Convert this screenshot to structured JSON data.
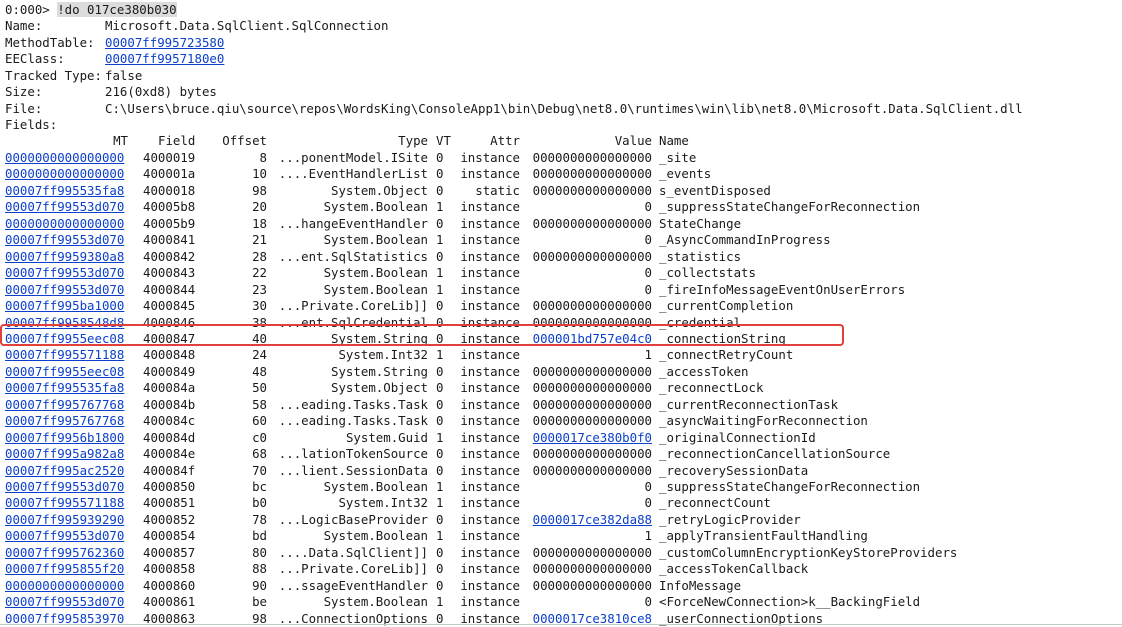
{
  "prompt": "0:000> ",
  "command": "!do 017ce380b030",
  "object_info": [
    {
      "label": "Name:",
      "value": "Microsoft.Data.SqlClient.SqlConnection",
      "link": false
    },
    {
      "label": "MethodTable:",
      "value": "00007ff995723580",
      "link": true
    },
    {
      "label": "EEClass:",
      "value": "00007ff9957180e0",
      "link": true
    },
    {
      "label": "Tracked Type:",
      "value": "false",
      "link": false
    },
    {
      "label": "Size:",
      "value": "216(0xd8) bytes",
      "link": false
    },
    {
      "label": "File:",
      "value": "C:\\Users\\bruce.qiu\\source\\repos\\WordsKing\\ConsoleApp1\\bin\\Debug\\net8.0\\runtimes\\win\\lib\\net8.0\\Microsoft.Data.SqlClient.dll",
      "link": false
    }
  ],
  "fields_label": "Fields:",
  "headers": {
    "mt": "MT",
    "field": "Field",
    "offset": "Offset",
    "type": "Type",
    "vt": "VT",
    "attr": "Attr",
    "value": "Value",
    "name": "Name"
  },
  "fields": [
    {
      "mt": "0000000000000000",
      "field": "4000019",
      "offset": "8",
      "type": "...ponentModel.ISite",
      "vt": "0",
      "attr": "instance",
      "value": "0000000000000000",
      "value_link": false,
      "name": "_site"
    },
    {
      "mt": "0000000000000000",
      "field": "400001a",
      "offset": "10",
      "type": "....EventHandlerList",
      "vt": "0",
      "attr": "instance",
      "value": "0000000000000000",
      "value_link": false,
      "name": "_events"
    },
    {
      "mt": "00007ff995535fa8",
      "field": "4000018",
      "offset": "98",
      "type": "System.Object",
      "vt": "0",
      "attr": "static",
      "value": "0000000000000000",
      "value_link": false,
      "name": "s_eventDisposed"
    },
    {
      "mt": "00007ff99553d070",
      "field": "40005b8",
      "offset": "20",
      "type": "System.Boolean",
      "vt": "1",
      "attr": "instance",
      "value": "0",
      "value_link": false,
      "name": "_suppressStateChangeForReconnection"
    },
    {
      "mt": "0000000000000000",
      "field": "40005b9",
      "offset": "18",
      "type": "...hangeEventHandler",
      "vt": "0",
      "attr": "instance",
      "value": "0000000000000000",
      "value_link": false,
      "name": "StateChange"
    },
    {
      "mt": "00007ff99553d070",
      "field": "4000841",
      "offset": "21",
      "type": "System.Boolean",
      "vt": "1",
      "attr": "instance",
      "value": "0",
      "value_link": false,
      "name": "_AsyncCommandInProgress"
    },
    {
      "mt": "00007ff9959380a8",
      "field": "4000842",
      "offset": "28",
      "type": "...ent.SqlStatistics",
      "vt": "0",
      "attr": "instance",
      "value": "0000000000000000",
      "value_link": false,
      "name": "_statistics"
    },
    {
      "mt": "00007ff99553d070",
      "field": "4000843",
      "offset": "22",
      "type": "System.Boolean",
      "vt": "1",
      "attr": "instance",
      "value": "0",
      "value_link": false,
      "name": "_collectstats"
    },
    {
      "mt": "00007ff99553d070",
      "field": "4000844",
      "offset": "23",
      "type": "System.Boolean",
      "vt": "1",
      "attr": "instance",
      "value": "0",
      "value_link": false,
      "name": "_fireInfoMessageEventOnUserErrors"
    },
    {
      "mt": "00007ff995ba1000",
      "field": "4000845",
      "offset": "30",
      "type": "...Private.CoreLib]]",
      "vt": "0",
      "attr": "instance",
      "value": "0000000000000000",
      "value_link": false,
      "name": "_currentCompletion"
    },
    {
      "mt": "00007ff9958548d8",
      "field": "4000846",
      "offset": "38",
      "type": "...ent.SqlCredential",
      "vt": "0",
      "attr": "instance",
      "value": "0000000000000000",
      "value_link": false,
      "name": "_credential"
    },
    {
      "mt": "00007ff9955eec08",
      "field": "4000847",
      "offset": "40",
      "type": "System.String",
      "vt": "0",
      "attr": "instance",
      "value": "000001bd757e04c0",
      "value_link": true,
      "name": "_connectionString"
    },
    {
      "mt": "00007ff995571188",
      "field": "4000848",
      "offset": "24",
      "type": "System.Int32",
      "vt": "1",
      "attr": "instance",
      "value": "1",
      "value_link": false,
      "name": "_connectRetryCount"
    },
    {
      "mt": "00007ff9955eec08",
      "field": "4000849",
      "offset": "48",
      "type": "System.String",
      "vt": "0",
      "attr": "instance",
      "value": "0000000000000000",
      "value_link": false,
      "name": "_accessToken"
    },
    {
      "mt": "00007ff995535fa8",
      "field": "400084a",
      "offset": "50",
      "type": "System.Object",
      "vt": "0",
      "attr": "instance",
      "value": "0000000000000000",
      "value_link": false,
      "name": "_reconnectLock"
    },
    {
      "mt": "00007ff995767768",
      "field": "400084b",
      "offset": "58",
      "type": "...eading.Tasks.Task",
      "vt": "0",
      "attr": "instance",
      "value": "0000000000000000",
      "value_link": false,
      "name": "_currentReconnectionTask"
    },
    {
      "mt": "00007ff995767768",
      "field": "400084c",
      "offset": "60",
      "type": "...eading.Tasks.Task",
      "vt": "0",
      "attr": "instance",
      "value": "0000000000000000",
      "value_link": false,
      "name": "_asyncWaitingForReconnection"
    },
    {
      "mt": "00007ff9956b1800",
      "field": "400084d",
      "offset": "c0",
      "type": "System.Guid",
      "vt": "1",
      "attr": "instance",
      "value": "0000017ce380b0f0",
      "value_link": true,
      "name": "_originalConnectionId"
    },
    {
      "mt": "00007ff995a982a8",
      "field": "400084e",
      "offset": "68",
      "type": "...lationTokenSource",
      "vt": "0",
      "attr": "instance",
      "value": "0000000000000000",
      "value_link": false,
      "name": "_reconnectionCancellationSource"
    },
    {
      "mt": "00007ff995ac2520",
      "field": "400084f",
      "offset": "70",
      "type": "...lient.SessionData",
      "vt": "0",
      "attr": "instance",
      "value": "0000000000000000",
      "value_link": false,
      "name": "_recoverySessionData"
    },
    {
      "mt": "00007ff99553d070",
      "field": "4000850",
      "offset": "bc",
      "type": "System.Boolean",
      "vt": "1",
      "attr": "instance",
      "value": "0",
      "value_link": false,
      "name": "_suppressStateChangeForReconnection"
    },
    {
      "mt": "00007ff995571188",
      "field": "4000851",
      "offset": "b0",
      "type": "System.Int32",
      "vt": "1",
      "attr": "instance",
      "value": "0",
      "value_link": false,
      "name": "_reconnectCount"
    },
    {
      "mt": "00007ff995939290",
      "field": "4000852",
      "offset": "78",
      "type": "...LogicBaseProvider",
      "vt": "0",
      "attr": "instance",
      "value": "0000017ce382da88",
      "value_link": true,
      "name": "_retryLogicProvider"
    },
    {
      "mt": "00007ff99553d070",
      "field": "4000854",
      "offset": "bd",
      "type": "System.Boolean",
      "vt": "1",
      "attr": "instance",
      "value": "1",
      "value_link": false,
      "name": "_applyTransientFaultHandling"
    },
    {
      "mt": "00007ff995762360",
      "field": "4000857",
      "offset": "80",
      "type": "....Data.SqlClient]]",
      "vt": "0",
      "attr": "instance",
      "value": "0000000000000000",
      "value_link": false,
      "name": "_customColumnEncryptionKeyStoreProviders"
    },
    {
      "mt": "00007ff995855f20",
      "field": "4000858",
      "offset": "88",
      "type": "...Private.CoreLib]]",
      "vt": "0",
      "attr": "instance",
      "value": "0000000000000000",
      "value_link": false,
      "name": "_accessTokenCallback"
    },
    {
      "mt": "0000000000000000",
      "field": "4000860",
      "offset": "90",
      "type": "...ssageEventHandler",
      "vt": "0",
      "attr": "instance",
      "value": "0000000000000000",
      "value_link": false,
      "name": "InfoMessage"
    },
    {
      "mt": "00007ff99553d070",
      "field": "4000861",
      "offset": "be",
      "type": "System.Boolean",
      "vt": "1",
      "attr": "instance",
      "value": "0",
      "value_link": false,
      "name": "<ForceNewConnection>k__BackingField"
    },
    {
      "mt": "00007ff995853970",
      "field": "4000863",
      "offset": "98",
      "type": "...ConnectionOptions",
      "vt": "0",
      "attr": "instance",
      "value": "0000017ce3810ce8",
      "value_link": true,
      "name": "_userConnectionOptions"
    }
  ],
  "highlight_color": "#e2413b",
  "link_color": "#0b3fcc"
}
